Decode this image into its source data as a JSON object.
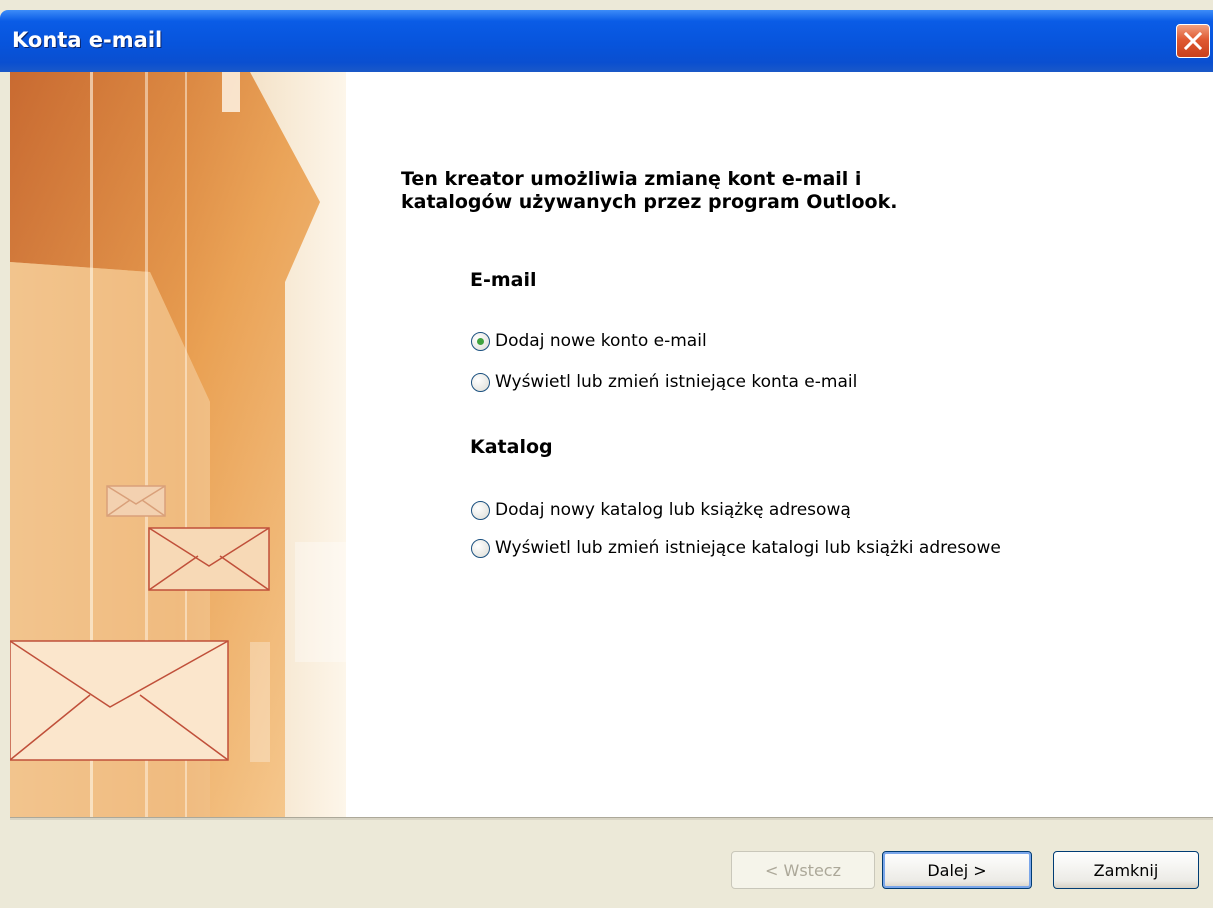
{
  "window": {
    "title": "Konta e-mail"
  },
  "heading": "Ten kreator umożliwia zmianę kont e-mail i katalogów używanych przez program Outlook.",
  "email_section": {
    "title": "E-mail",
    "options": [
      {
        "label": "Dodaj nowe konto e-mail",
        "checked": true
      },
      {
        "label": "Wyświetl lub zmień istniejące konta e-mail",
        "checked": false
      }
    ]
  },
  "directory_section": {
    "title": "Katalog",
    "options": [
      {
        "label": "Dodaj nowy katalog lub książkę adresową",
        "checked": false
      },
      {
        "label": "Wyświetl lub zmień istniejące katalogi lub książki adresowe",
        "checked": false
      }
    ]
  },
  "buttons": {
    "back": "< Wstecz",
    "next": "Dalej >",
    "close": "Zamknij"
  },
  "icons": {
    "close": "close-icon",
    "envelope": "envelope-icon"
  },
  "colors": {
    "titlebar": "#0754dc",
    "accent_orange": "#e8a052",
    "radio_check": "#3fa33f"
  }
}
